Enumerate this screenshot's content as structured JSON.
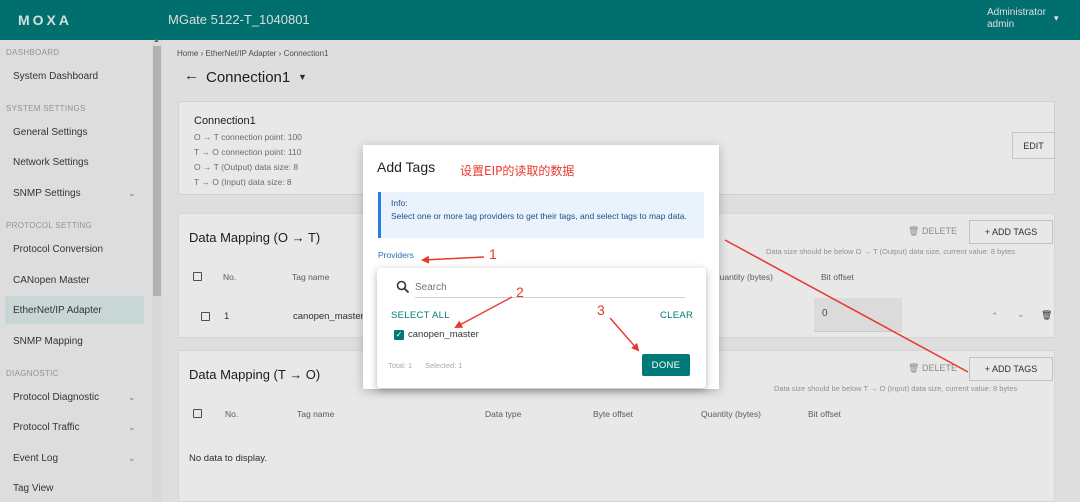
{
  "header": {
    "logo": "MOXA",
    "app_title": "MGate 5122-T_1040801",
    "user_role": "Administrator",
    "user_name": "admin"
  },
  "sidebar": {
    "sections": [
      {
        "label": "DASHBOARD",
        "items": [
          {
            "label": "System Dashboard",
            "has_submenu": false
          }
        ]
      },
      {
        "label": "SYSTEM SETTINGS",
        "items": [
          {
            "label": "General Settings",
            "has_submenu": false
          },
          {
            "label": "Network Settings",
            "has_submenu": false
          },
          {
            "label": "SNMP Settings",
            "has_submenu": true
          }
        ]
      },
      {
        "label": "PROTOCOL SETTING",
        "items": [
          {
            "label": "Protocol Conversion",
            "has_submenu": false
          },
          {
            "label": "CANopen Master",
            "has_submenu": false
          },
          {
            "label": "EtherNet/IP Adapter",
            "has_submenu": false,
            "active": true
          },
          {
            "label": "SNMP Mapping",
            "has_submenu": false
          }
        ]
      },
      {
        "label": "DIAGNOSTIC",
        "items": [
          {
            "label": "Protocol Diagnostic",
            "has_submenu": true
          },
          {
            "label": "Protocol Traffic",
            "has_submenu": true
          },
          {
            "label": "Event Log",
            "has_submenu": true
          },
          {
            "label": "Tag View",
            "has_submenu": false
          }
        ]
      }
    ]
  },
  "main": {
    "breadcrumb": "Home › EtherNet/IP Adapter › Connection1",
    "page_title": "Connection1",
    "connection": {
      "name": "Connection1",
      "lines": [
        "O → T connection point: 100",
        "T → O connection point: 110",
        "O → T (Output) data size: 8",
        "T → O (Input) data size: 8"
      ],
      "edit_label": "EDIT"
    },
    "mapping_ot": {
      "title": "Data Mapping (O → T)",
      "delete_label": "DELETE",
      "add_label": "+ ADD TAGS",
      "size_note": "Data size should be below O → T (Output) data size, current value: 8 bytes",
      "columns": {
        "no": "No.",
        "tag_name": "Tag name",
        "quantity": "Quantity (bytes)",
        "bit_offset": "Bit offset"
      },
      "rows": [
        {
          "no": "1",
          "tag_name": "canopen_master",
          "bit_offset": "0"
        }
      ]
    },
    "mapping_to": {
      "title": "Data Mapping (T → O)",
      "delete_label": "DELETE",
      "add_label": "+ ADD TAGS",
      "size_note": "Data size should be below T → O (Input) data size, current value: 8 bytes",
      "columns": {
        "no": "No.",
        "tag_name": "Tag name",
        "data_type": "Data type",
        "byte_offset": "Byte offset",
        "quantity": "Quantity (bytes)",
        "bit_offset": "Bit offset"
      },
      "empty": "No data to display."
    }
  },
  "dialog": {
    "title": "Add Tags",
    "note": "设置EIP的读取的数据",
    "info_label": "Info:",
    "info_text": "Select one or more tag providers to get their tags, and select tags to map data.",
    "providers_label": "Providers",
    "dropdown": {
      "search_placeholder": "Search",
      "select_all": "SELECT ALL",
      "clear": "CLEAR",
      "option": {
        "label": "canopen_master",
        "checked": true
      },
      "total": "Total: 1",
      "selected": "Selected: 1",
      "done": "DONE"
    }
  },
  "annotations": [
    "1",
    "2",
    "3"
  ],
  "colors": {
    "brand": "#007a78",
    "annotation": "#e8382c",
    "link": "#2a6fb6",
    "info_border": "#2a7de1"
  },
  "icons": [
    "back-arrow-icon",
    "caret-down-icon",
    "trash-icon",
    "search-icon",
    "check-icon",
    "chevron-up-icon",
    "chevron-down-icon"
  ]
}
